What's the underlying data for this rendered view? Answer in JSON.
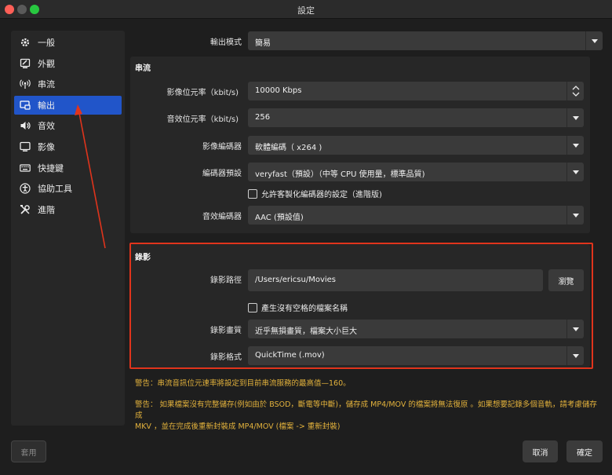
{
  "window": {
    "title": "設定"
  },
  "sidebar": {
    "items": [
      {
        "label": "一般",
        "icon": "gear-icon"
      },
      {
        "label": "外觀",
        "icon": "appearance-icon"
      },
      {
        "label": "串流",
        "icon": "broadcast-icon"
      },
      {
        "label": "輸出",
        "icon": "output-icon",
        "active": true
      },
      {
        "label": "音效",
        "icon": "speaker-icon"
      },
      {
        "label": "影像",
        "icon": "monitor-icon"
      },
      {
        "label": "快捷鍵",
        "icon": "keyboard-icon"
      },
      {
        "label": "協助工具",
        "icon": "accessibility-icon"
      },
      {
        "label": "進階",
        "icon": "tools-icon"
      }
    ]
  },
  "output_mode": {
    "label": "輸出模式",
    "value": "簡易"
  },
  "streaming": {
    "title": "串流",
    "video_bitrate": {
      "label": "影像位元率（kbit/s)",
      "value": "10000 Kbps"
    },
    "audio_bitrate": {
      "label": "音效位元率（kbit/s)",
      "value": "256"
    },
    "video_encoder": {
      "label": "影像編碼器",
      "value": "軟體編碼（ x264 )"
    },
    "encoder_preset": {
      "label": "編碼器預設",
      "value": "veryfast（預設）（中等 CPU 使用量，標準品質)"
    },
    "custom_encoder_checkbox": "允許客製化編碼器的設定（進階版)",
    "audio_encoder": {
      "label": "音效編碼器",
      "value": "AAC (預設值)"
    }
  },
  "recording": {
    "title": "錄影",
    "path": {
      "label": "錄影路徑",
      "value": "/Users/ericsu/Movies",
      "browse": "瀏覽"
    },
    "no_space_checkbox": "產生沒有空格的檔案名稱",
    "quality": {
      "label": "錄影畫質",
      "value": "近乎無損畫質，檔案大小巨大"
    },
    "format": {
      "label": "錄影格式",
      "value": "QuickTime (.mov)"
    }
  },
  "warnings": {
    "line1": "警告：串流音訊位元速率將設定到目前串流服務的最高值—160。",
    "line2a": "警告： 如果檔案沒有完整儲存(例如由於 BSOD，斷電等中斷)，儲存成 MP4/MOV 的檔案將無法復原 。如果想要記錄多個音軌，請考慮儲存成",
    "line2b": "MKV ，並在完成後重新封裝成 MP4/MOV (檔案 -> 重新封裝)"
  },
  "footer": {
    "apply": "套用",
    "cancel": "取消",
    "ok": "確定"
  },
  "colors": {
    "accent": "#2155c9",
    "highlight": "#e0341c",
    "warning": "#e3b23c"
  }
}
